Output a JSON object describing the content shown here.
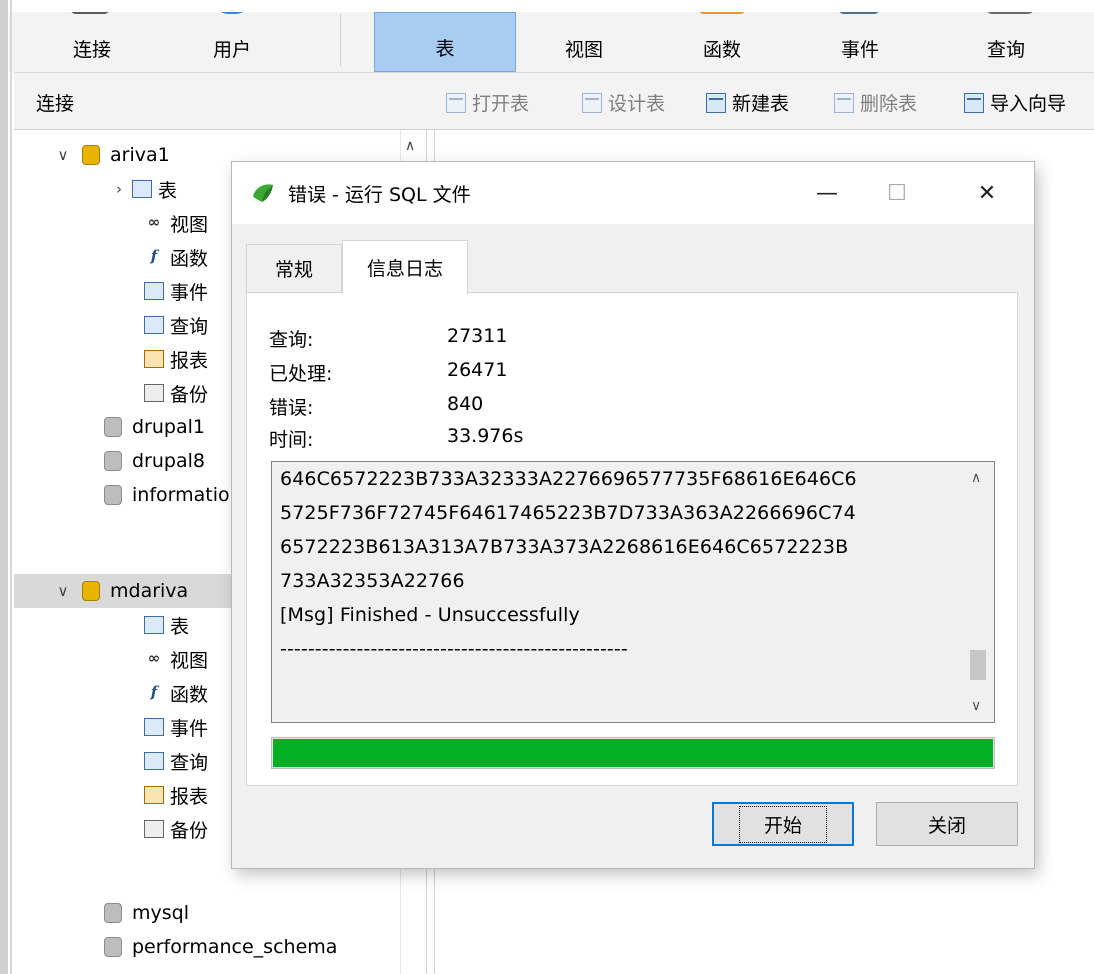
{
  "ribbon": {
    "items": [
      {
        "label": "连接"
      },
      {
        "label": "用户"
      },
      {
        "label": "表"
      },
      {
        "label": "视图"
      },
      {
        "label": "函数"
      },
      {
        "label": "事件"
      },
      {
        "label": "查询"
      }
    ],
    "active_index": 2,
    "active_color": "#a9cdf2"
  },
  "subbar": {
    "connection_heading": "连接",
    "tools": [
      {
        "label": "打开表",
        "icon": "open-table-icon",
        "enabled": false
      },
      {
        "label": "设计表",
        "icon": "design-table-icon",
        "enabled": false
      },
      {
        "label": "新建表",
        "icon": "new-table-icon",
        "enabled": true
      },
      {
        "label": "删除表",
        "icon": "delete-table-icon",
        "enabled": false
      },
      {
        "label": "导入向导",
        "icon": "import-wizard-icon",
        "enabled": true
      }
    ]
  },
  "tree": {
    "nodes": [
      {
        "label": "ariva1",
        "type": "database",
        "expanded": true
      },
      {
        "label": "表",
        "type": "tables"
      },
      {
        "label": "视图",
        "type": "views"
      },
      {
        "label": "函数",
        "type": "functions"
      },
      {
        "label": "事件",
        "type": "events"
      },
      {
        "label": "查询",
        "type": "queries"
      },
      {
        "label": "报表",
        "type": "reports"
      },
      {
        "label": "备份",
        "type": "backups"
      },
      {
        "label": "drupal1",
        "type": "database"
      },
      {
        "label": "drupal8",
        "type": "database"
      },
      {
        "label": "information_schema",
        "type": "database"
      },
      {
        "label": "mdariva",
        "type": "database",
        "expanded": true,
        "selected": true
      },
      {
        "label": "表",
        "type": "tables"
      },
      {
        "label": "视图",
        "type": "views"
      },
      {
        "label": "函数",
        "type": "functions"
      },
      {
        "label": "事件",
        "type": "events"
      },
      {
        "label": "查询",
        "type": "queries"
      },
      {
        "label": "报表",
        "type": "reports"
      },
      {
        "label": "备份",
        "type": "backups"
      },
      {
        "label": "mysql",
        "type": "database"
      },
      {
        "label": "performance_schema",
        "type": "database"
      }
    ]
  },
  "dialog": {
    "title": "错误 - 运行 SQL 文件",
    "title_icon": "navicat-icon",
    "tabs": [
      {
        "label": "常规"
      },
      {
        "label": "信息日志"
      }
    ],
    "active_tab": 1,
    "stats": [
      {
        "label": "查询:",
        "value": "27311"
      },
      {
        "label": "已处理:",
        "value": "26471"
      },
      {
        "label": "错误:",
        "value": "840"
      },
      {
        "label": "时间:",
        "value": "33.976s"
      }
    ],
    "log_lines": [
      "646C6572223B733A32333A2276696577735F68616E646C6",
      "5725F736F72745F64617465223B7D733A363A2266696C74",
      "6572223B613A313A7B733A373A2268616E646C6572223B",
      "733A32353A22766",
      "[Msg] Finished - Unsuccessfully",
      "--------------------------------------------------"
    ],
    "progress": 1.0,
    "progress_color": "#06b025",
    "start_button": "开始",
    "close_button": "关闭"
  }
}
